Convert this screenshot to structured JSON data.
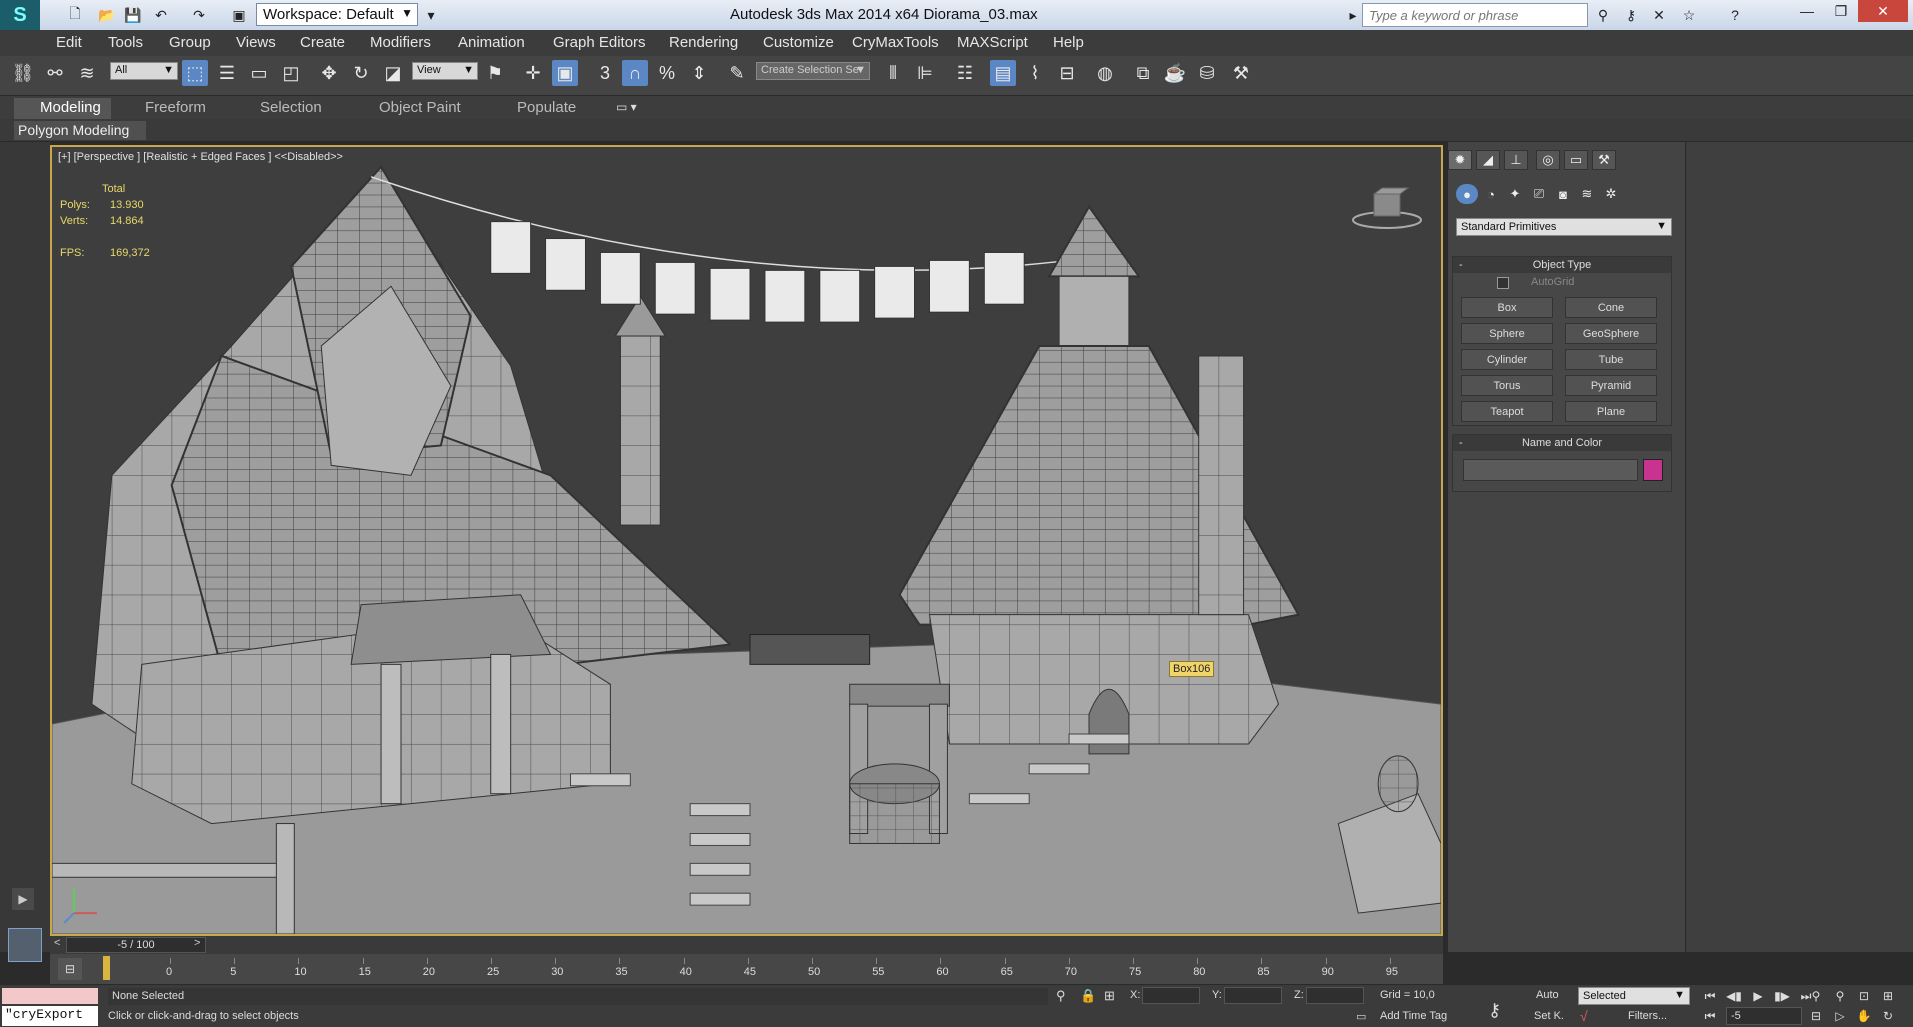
{
  "titlebar": {
    "workspace_label": "Workspace: Default",
    "window_title": "Autodesk 3ds Max  2014 x64      Diorama_03.max",
    "search_placeholder": "Type a keyword or phrase"
  },
  "menu": {
    "items": [
      "Edit",
      "Tools",
      "Group",
      "Views",
      "Create",
      "Modifiers",
      "Animation",
      "Graph Editors",
      "Rendering",
      "Customize",
      "CryMaxTools",
      "MAXScript",
      "Help"
    ]
  },
  "toolbar": {
    "selection_filter": "All",
    "ref_coord": "View",
    "named_selection": "Create Selection Se"
  },
  "ribbon": {
    "tabs": [
      "Modeling",
      "Freeform",
      "Selection",
      "Object Paint",
      "Populate"
    ],
    "panel_label": "Polygon Modeling"
  },
  "viewport": {
    "label": "[+] [Perspective ] [Realistic + Edged Faces ]  <<Disabled>>",
    "stats": {
      "total_label": "Total",
      "polys_label": "Polys:",
      "polys_value": "13.930",
      "verts_label": "Verts:",
      "verts_value": "14.864",
      "fps_label": "FPS:",
      "fps_value": "169,372"
    },
    "tooltip": "Box106"
  },
  "command_panel": {
    "category_dropdown": "Standard Primitives",
    "object_type": {
      "title": "Object Type",
      "autogrid_label": "AutoGrid",
      "buttons": [
        "Box",
        "Cone",
        "Sphere",
        "GeoSphere",
        "Cylinder",
        "Tube",
        "Torus",
        "Pyramid",
        "Teapot",
        "Plane"
      ]
    },
    "name_and_color": {
      "title": "Name and Color",
      "swatch_color": "#c7338e"
    },
    "collapse_glyph": "-"
  },
  "timeline": {
    "slider_text": "-5 / 100",
    "ticks": [
      "0",
      "5",
      "10",
      "15",
      "20",
      "25",
      "30",
      "35",
      "40",
      "45",
      "50",
      "55",
      "60",
      "65",
      "70",
      "75",
      "80",
      "85",
      "90",
      "95"
    ]
  },
  "status": {
    "listener_text": "\"cryExport",
    "selection_status": "None Selected",
    "prompt": "Click or click-and-drag to select objects",
    "x_label": "X:",
    "y_label": "Y:",
    "z_label": "Z:",
    "grid": "Grid = 10,0",
    "add_time_tag": "Add Time Tag",
    "auto_key": "Auto",
    "set_key": "Set K.",
    "key_filter_selected": "Selected",
    "filters": "Filters...",
    "frame_field": "-5"
  },
  "colors": {
    "viewport_border": "#c8a84a",
    "active_tool": "#5b88c4",
    "tooltip_bg": "#f1d56a"
  }
}
